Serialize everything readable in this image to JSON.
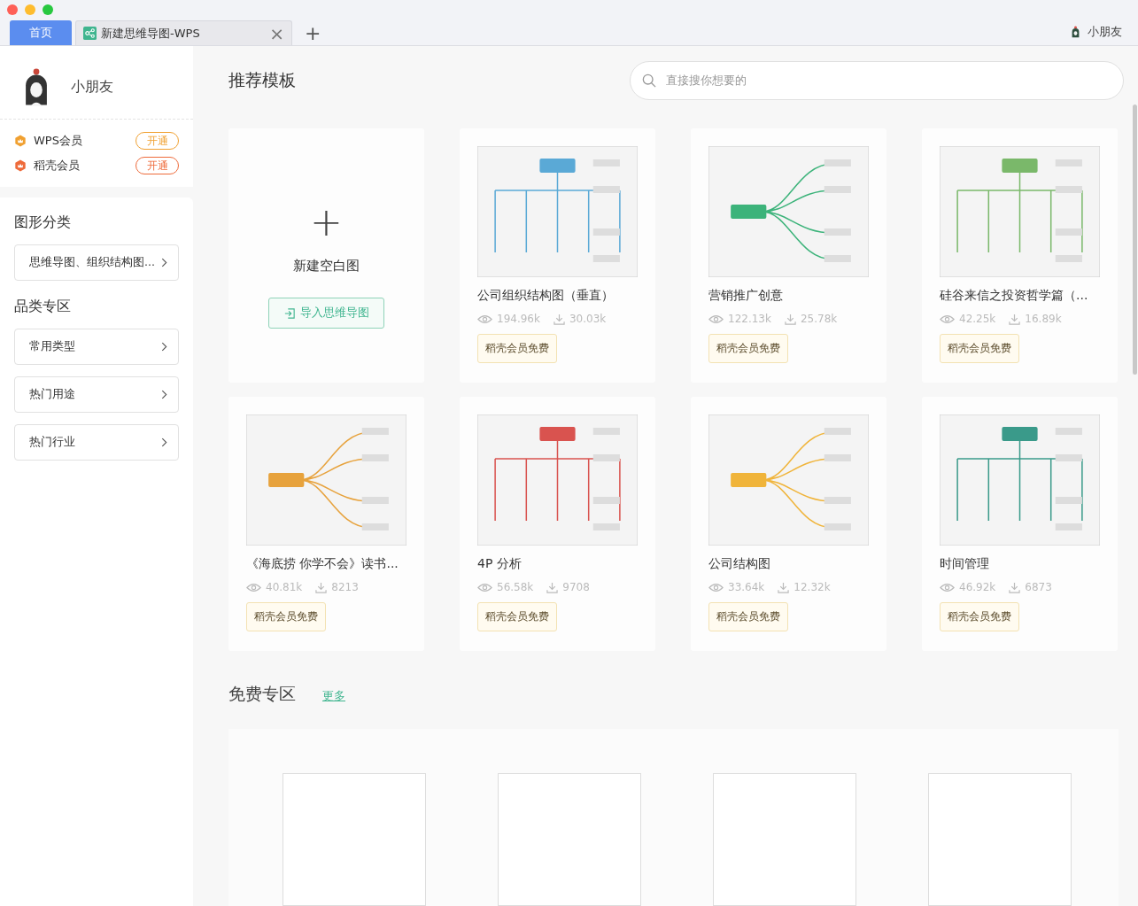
{
  "tabs": [
    {
      "label": "首页",
      "selected": true,
      "kind": "home"
    },
    {
      "label": "新建思维导图-WPS",
      "selected": false,
      "kind": "document",
      "close": "×"
    }
  ],
  "new_tab": "+",
  "account": {
    "name": "小朋友"
  },
  "profile": {
    "name": "小朋友"
  },
  "memberships": [
    {
      "label": "WPS会员",
      "action": "开通",
      "color": "#f0a030"
    },
    {
      "label": "稻壳会员",
      "action": "开通",
      "color": "#ee6a3a"
    }
  ],
  "sidebar": {
    "sections": [
      {
        "title": "图形分类",
        "items": [
          "思维导图、组织结构图..."
        ]
      },
      {
        "title": "品类专区",
        "items": [
          "常用类型",
          "热门用途",
          "热门行业"
        ]
      }
    ]
  },
  "main": {
    "title": "推荐模板",
    "search": {
      "placeholder": "直接搜你想要的"
    },
    "new_card": {
      "plus": "+",
      "title": "新建空白图",
      "import_button": "导入思维导图"
    },
    "templates": [
      {
        "title": "公司组织结构图（垂直）",
        "views": "194.96k",
        "downloads": "30.03k",
        "badge": "稻壳会员免费"
      },
      {
        "title": "营销推广创意",
        "views": "122.13k",
        "downloads": "25.78k",
        "badge": "稻壳会员免费"
      },
      {
        "title": "硅谷来信之投资哲学篇（...",
        "views": "42.25k",
        "downloads": "16.89k",
        "badge": "稻壳会员免费"
      },
      {
        "title": "《海底捞 你学不会》读书...",
        "views": "40.81k",
        "downloads": "8213",
        "badge": "稻壳会员免费"
      },
      {
        "title": "4P 分析",
        "views": "56.58k",
        "downloads": "9708",
        "badge": "稻壳会员免费"
      },
      {
        "title": "公司结构图",
        "views": "33.64k",
        "downloads": "12.32k",
        "badge": "稻壳会员免费"
      },
      {
        "title": "时间管理",
        "views": "46.92k",
        "downloads": "6873",
        "badge": "稻壳会员免费"
      }
    ]
  },
  "free_section": {
    "title": "免费专区",
    "more_link": "更多",
    "cards": [
      {
        "kind": "placeholder"
      },
      {
        "kind": "placeholder"
      },
      {
        "kind": "placeholder"
      },
      {
        "kind": "placeholder"
      }
    ]
  }
}
